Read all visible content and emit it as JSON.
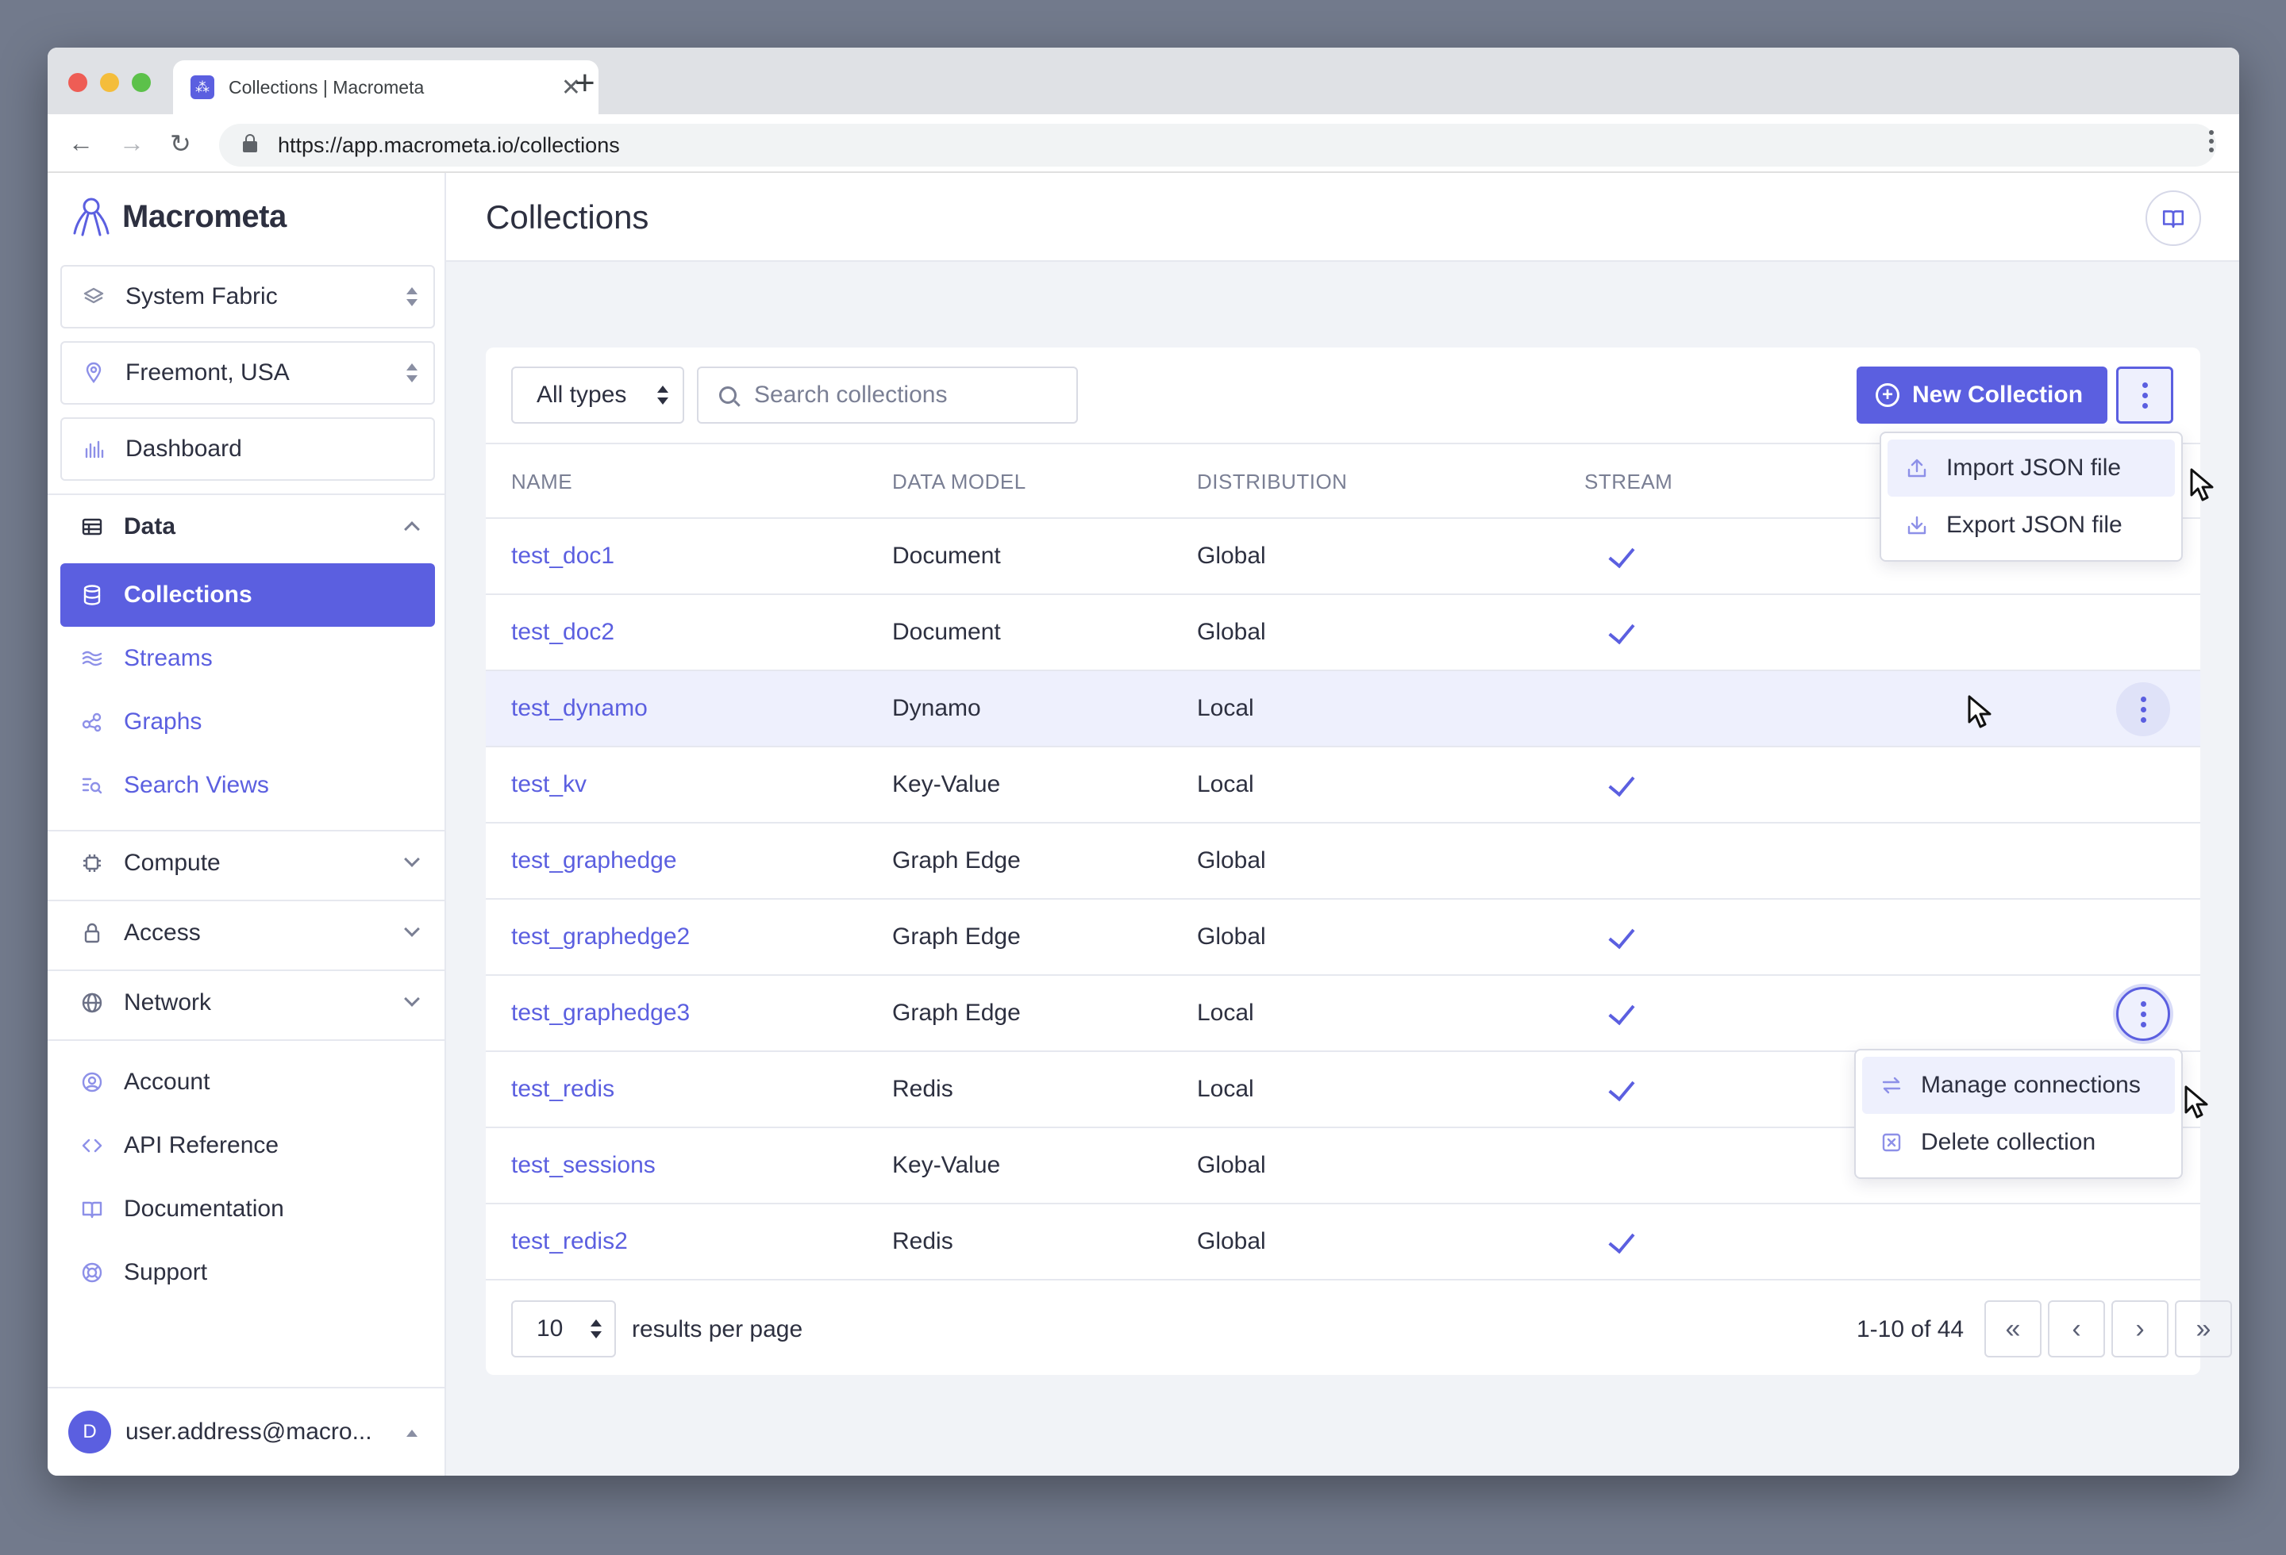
{
  "browser": {
    "tab_title": "Collections | Macrometa",
    "url": "https://app.macrometa.io/collections",
    "new_tab_symbol": "+",
    "close_tab_symbol": "✕"
  },
  "brand": {
    "name": "Macrometa",
    "accent": "#5b5fe0"
  },
  "sidebar": {
    "fabric": "System Fabric",
    "region": "Freemont, USA",
    "dashboard": "Dashboard",
    "data_section": "Data",
    "data_items": [
      {
        "label": "Collections",
        "icon": "database-icon"
      },
      {
        "label": "Streams",
        "icon": "waves-icon"
      },
      {
        "label": "Graphs",
        "icon": "graph-icon"
      },
      {
        "label": "Search Views",
        "icon": "search-list-icon"
      }
    ],
    "sections": [
      {
        "label": "Compute",
        "icon": "chip-icon"
      },
      {
        "label": "Access",
        "icon": "lock-icon"
      },
      {
        "label": "Network",
        "icon": "globe-icon"
      }
    ],
    "links": [
      {
        "label": "Account",
        "icon": "account-icon"
      },
      {
        "label": "API Reference",
        "icon": "code-icon"
      },
      {
        "label": "Documentation",
        "icon": "book-icon"
      },
      {
        "label": "Support",
        "icon": "lifebuoy-icon"
      }
    ],
    "user_initial": "D",
    "user_email": "user.address@macro..."
  },
  "main": {
    "title": "Collections",
    "type_filter": "All types",
    "search_placeholder": "Search collections",
    "new_button": "New Collection",
    "columns": [
      "NAME",
      "DATA MODEL",
      "DISTRIBUTION",
      "STREAM"
    ],
    "rows": [
      {
        "name": "test_doc1",
        "model": "Document",
        "distribution": "Global",
        "stream": true
      },
      {
        "name": "test_doc2",
        "model": "Document",
        "distribution": "Global",
        "stream": true
      },
      {
        "name": "test_dynamo",
        "model": "Dynamo",
        "distribution": "Local",
        "stream": false
      },
      {
        "name": "test_kv",
        "model": "Key-Value",
        "distribution": "Local",
        "stream": true
      },
      {
        "name": "test_graphedge",
        "model": "Graph Edge",
        "distribution": "Global",
        "stream": false
      },
      {
        "name": "test_graphedge2",
        "model": "Graph Edge",
        "distribution": "Global",
        "stream": true
      },
      {
        "name": "test_graphedge3",
        "model": "Graph Edge",
        "distribution": "Local",
        "stream": true
      },
      {
        "name": "test_redis",
        "model": "Redis",
        "distribution": "Local",
        "stream": true
      },
      {
        "name": "test_sessions",
        "model": "Key-Value",
        "distribution": "Global",
        "stream": false
      },
      {
        "name": "test_redis2",
        "model": "Redis",
        "distribution": "Global",
        "stream": true
      }
    ],
    "header_menu": [
      "Import JSON file",
      "Export JSON file"
    ],
    "row_menu": [
      "Manage connections",
      "Delete collection"
    ],
    "per_page": "10",
    "per_page_label": "results per page",
    "range": "1-10 of 44"
  }
}
